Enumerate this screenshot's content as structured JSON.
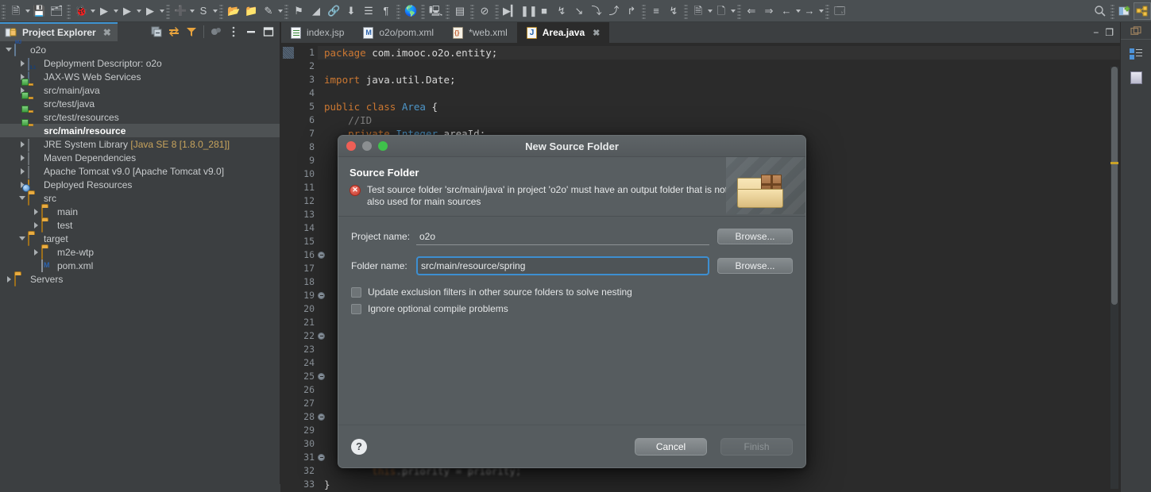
{
  "toolbar": {
    "icons": [
      {
        "name": "new-wizard-icon",
        "glyph": "🗎",
        "dropdown": true
      },
      {
        "name": "save-icon",
        "glyph": "💾",
        "dropdown": false
      },
      {
        "name": "save-all-icon",
        "glyph": "🗂",
        "dropdown": false
      },
      {
        "name": "debug-icon",
        "glyph": "🐞",
        "dropdown": true
      },
      {
        "name": "run-icon",
        "glyph": "▶",
        "dropdown": true
      },
      {
        "name": "run-server-icon",
        "glyph": "▶",
        "dropdown": true
      },
      {
        "name": "run-coverage-icon",
        "glyph": "▶",
        "dropdown": true
      },
      {
        "name": "new-java-project-icon",
        "glyph": "➕",
        "dropdown": true
      },
      {
        "name": "search-spring-icon",
        "glyph": "S",
        "dropdown": true
      },
      {
        "name": "open-type-icon",
        "glyph": "📂",
        "dropdown": false
      },
      {
        "name": "open-resource-icon",
        "glyph": "📁",
        "dropdown": false
      },
      {
        "name": "edit-icon",
        "glyph": "✎",
        "dropdown": true
      },
      {
        "name": "marker-icon",
        "glyph": "⚑",
        "dropdown": false
      },
      {
        "name": "ruler-icon",
        "glyph": "◢",
        "dropdown": false
      },
      {
        "name": "link-icon",
        "glyph": "🔗",
        "dropdown": false
      },
      {
        "name": "next-annotation-icon",
        "glyph": "⬇",
        "dropdown": false
      },
      {
        "name": "outline-list-icon",
        "glyph": "☰",
        "dropdown": false
      },
      {
        "name": "paragraph-icon",
        "glyph": "¶",
        "dropdown": false
      },
      {
        "name": "browser-icon",
        "glyph": "🌎",
        "dropdown": false
      },
      {
        "name": "new-server-icon",
        "glyph": "🖳",
        "dropdown": false
      },
      {
        "name": "console-icon",
        "glyph": "▤",
        "dropdown": false
      },
      {
        "name": "skip-breakpoints-icon",
        "glyph": "⊘",
        "dropdown": false
      },
      {
        "name": "resume-icon",
        "glyph": "▶▎",
        "dropdown": false
      },
      {
        "name": "suspend-icon",
        "glyph": "❚❚",
        "dropdown": false
      },
      {
        "name": "terminate-icon",
        "glyph": "■",
        "dropdown": false
      },
      {
        "name": "disconnect-icon",
        "glyph": "↯",
        "dropdown": false
      },
      {
        "name": "step-into-icon",
        "glyph": "↘",
        "dropdown": false
      },
      {
        "name": "step-over-icon",
        "glyph": "⤵",
        "dropdown": false
      },
      {
        "name": "step-return-icon",
        "glyph": "⤴",
        "dropdown": false
      },
      {
        "name": "drop-to-frame-icon",
        "glyph": "↱",
        "dropdown": false
      },
      {
        "name": "use-step-filters-icon",
        "glyph": "≡",
        "dropdown": false
      },
      {
        "name": "toggle-breakpoint-icon",
        "glyph": "↯",
        "dropdown": false
      },
      {
        "name": "previous-edit-icon",
        "glyph": "🗎",
        "dropdown": true
      },
      {
        "name": "next-edit-icon",
        "glyph": "🗋",
        "dropdown": true
      },
      {
        "name": "back-all-icon",
        "glyph": "⇐",
        "dropdown": false
      },
      {
        "name": "forward-all-icon",
        "glyph": "⇒",
        "dropdown": false
      },
      {
        "name": "back-icon",
        "glyph": "←",
        "dropdown": true
      },
      {
        "name": "forward-icon",
        "glyph": "→",
        "dropdown": true
      },
      {
        "name": "open-perspective-icon",
        "glyph": "🗔",
        "dropdown": false
      }
    ],
    "right_icons": [
      {
        "name": "quick-access-search-icon",
        "glyph": "🔍"
      },
      {
        "name": "open-perspective-icon",
        "glyph": "⊞"
      },
      {
        "name": "java-ee-perspective-icon",
        "glyph": "⚙"
      }
    ]
  },
  "explorer": {
    "tab_label": "Project Explorer",
    "tools": [
      {
        "name": "collapse-all-icon",
        "glyph": "⊟"
      },
      {
        "name": "link-with-editor-icon",
        "glyph": "⇄"
      },
      {
        "name": "view-menu-filter-icon",
        "glyph": "▼"
      },
      {
        "name": "focus-on-active-task-icon",
        "glyph": "⬢"
      },
      {
        "name": "view-menu-icon",
        "glyph": "⋮"
      },
      {
        "name": "minimize-icon",
        "glyph": "−"
      },
      {
        "name": "maximize-icon",
        "glyph": "□"
      }
    ],
    "tree": [
      {
        "label": "o2o",
        "indent": 0,
        "twisty": "down",
        "icon": "project",
        "selected": false
      },
      {
        "label": "Deployment Descriptor: o2o",
        "indent": 1,
        "twisty": "right",
        "icon": "deploy",
        "selected": false
      },
      {
        "label": "JAX-WS Web Services",
        "indent": 1,
        "twisty": "right",
        "icon": "ws",
        "selected": false
      },
      {
        "label": "src/main/java",
        "indent": 1,
        "twisty": "right",
        "icon": "srcfolder",
        "selected": false
      },
      {
        "label": "src/test/java",
        "indent": 1,
        "twisty": "none",
        "icon": "srcfolder",
        "selected": false
      },
      {
        "label": "src/test/resources",
        "indent": 1,
        "twisty": "none",
        "icon": "srcfolder",
        "selected": false
      },
      {
        "label": "src/main/resource",
        "indent": 1,
        "twisty": "none",
        "icon": "srcfolder",
        "selected": true
      },
      {
        "label": "JRE System Library",
        "suffix": " [Java SE 8 [1.8.0_281]]",
        "indent": 1,
        "twisty": "right",
        "icon": "lib",
        "selected": false
      },
      {
        "label": "Maven Dependencies",
        "indent": 1,
        "twisty": "right",
        "icon": "lib",
        "selected": false
      },
      {
        "label": "Apache Tomcat v9.0 [Apache Tomcat v9.0]",
        "indent": 1,
        "twisty": "right",
        "icon": "lib",
        "selected": false
      },
      {
        "label": "Deployed Resources",
        "indent": 1,
        "twisty": "right",
        "icon": "deployed",
        "selected": false
      },
      {
        "label": "src",
        "indent": 1,
        "twisty": "down",
        "icon": "folder",
        "selected": false
      },
      {
        "label": "main",
        "indent": 2,
        "twisty": "right",
        "icon": "folder",
        "selected": false
      },
      {
        "label": "test",
        "indent": 2,
        "twisty": "right",
        "icon": "folder",
        "selected": false
      },
      {
        "label": "target",
        "indent": 1,
        "twisty": "down",
        "icon": "folder",
        "selected": false
      },
      {
        "label": "m2e-wtp",
        "indent": 2,
        "twisty": "right",
        "icon": "folder",
        "selected": false
      },
      {
        "label": "pom.xml",
        "indent": 2,
        "twisty": "none",
        "icon": "maven",
        "selected": false
      },
      {
        "label": "Servers",
        "indent": 0,
        "twisty": "right",
        "icon": "folder",
        "selected": false
      }
    ]
  },
  "editor": {
    "tabs": [
      {
        "label": "index.jsp",
        "icon": "jsp-file-icon",
        "active": false,
        "closable": false
      },
      {
        "label": "o2o/pom.xml",
        "icon": "maven-file-icon",
        "active": false,
        "closable": false
      },
      {
        "label": "*web.xml",
        "icon": "xml-file-icon",
        "active": false,
        "closable": false
      },
      {
        "label": "Area.java",
        "icon": "java-file-icon",
        "active": true,
        "closable": true
      }
    ],
    "window_buttons": [
      {
        "name": "minimize-editor-icon",
        "glyph": "−"
      },
      {
        "name": "restore-editor-icon",
        "glyph": "❐"
      }
    ],
    "lines": [
      {
        "n": 1,
        "fold": false,
        "cur": true,
        "html": "<span class='kw'>package</span> <span class='pl'>com.imooc.o2o.entity;</span>"
      },
      {
        "n": 2,
        "fold": false,
        "cur": false,
        "html": ""
      },
      {
        "n": 3,
        "fold": false,
        "cur": false,
        "html": "<span class='kw'>import</span> <span class='pl'>java.util.Date;</span>"
      },
      {
        "n": 4,
        "fold": false,
        "cur": false,
        "html": ""
      },
      {
        "n": 5,
        "fold": false,
        "cur": false,
        "html": "<span class='kw'>public</span> <span class='kw'>class</span> <span class='ty'>Area</span> <span class='pl'>{</span>"
      },
      {
        "n": 6,
        "fold": false,
        "cur": false,
        "html": "    <span class='cm'>//ID</span>"
      },
      {
        "n": 7,
        "fold": false,
        "cur": false,
        "html": "    <span class='kw'>private</span> <span class='ty'>Integer</span> <span class='pl'>areaId;</span>"
      },
      {
        "n": 8,
        "fold": false,
        "cur": false,
        "html": ""
      },
      {
        "n": 9,
        "fold": false,
        "cur": false,
        "html": ""
      },
      {
        "n": 10,
        "fold": false,
        "cur": false,
        "html": ""
      },
      {
        "n": 11,
        "fold": false,
        "cur": false,
        "html": ""
      },
      {
        "n": 12,
        "fold": false,
        "cur": false,
        "html": ""
      },
      {
        "n": 13,
        "fold": false,
        "cur": false,
        "html": ""
      },
      {
        "n": 14,
        "fold": false,
        "cur": false,
        "html": ""
      },
      {
        "n": 15,
        "fold": false,
        "cur": false,
        "html": ""
      },
      {
        "n": 16,
        "fold": true,
        "cur": false,
        "html": ""
      },
      {
        "n": 17,
        "fold": false,
        "cur": false,
        "html": ""
      },
      {
        "n": 18,
        "fold": false,
        "cur": false,
        "html": ""
      },
      {
        "n": 19,
        "fold": true,
        "cur": false,
        "html": ""
      },
      {
        "n": 20,
        "fold": false,
        "cur": false,
        "html": ""
      },
      {
        "n": 21,
        "fold": false,
        "cur": false,
        "html": ""
      },
      {
        "n": 22,
        "fold": true,
        "cur": false,
        "html": ""
      },
      {
        "n": 23,
        "fold": false,
        "cur": false,
        "html": ""
      },
      {
        "n": 24,
        "fold": false,
        "cur": false,
        "html": ""
      },
      {
        "n": 25,
        "fold": true,
        "cur": false,
        "html": ""
      },
      {
        "n": 26,
        "fold": false,
        "cur": false,
        "html": ""
      },
      {
        "n": 27,
        "fold": false,
        "cur": false,
        "html": ""
      },
      {
        "n": 28,
        "fold": true,
        "cur": false,
        "html": ""
      },
      {
        "n": 29,
        "fold": false,
        "cur": false,
        "html": ""
      },
      {
        "n": 30,
        "fold": false,
        "cur": false,
        "html": ""
      },
      {
        "n": 31,
        "fold": true,
        "cur": false,
        "html": ""
      },
      {
        "n": 32,
        "fold": false,
        "cur": false,
        "blur": true,
        "html": "        <span class='kw'>this</span><span class='pl'>.priority = priority;</span>"
      },
      {
        "n": 33,
        "fold": false,
        "cur": false,
        "html": "<span class='pl'>}</span>"
      }
    ]
  },
  "right_strip": {
    "buttons": [
      {
        "name": "restore-view-icon",
        "glyph": "❐"
      },
      {
        "name": "outline-view-icon",
        "glyph": "≡"
      },
      {
        "name": "task-list-view-icon",
        "glyph": "▤"
      }
    ]
  },
  "dialog": {
    "title": "New Source Folder",
    "traffic_lights": [
      "close",
      "minimize",
      "zoom"
    ],
    "header_title": "Source Folder",
    "error_message": "Test source folder 'src/main/java' in project 'o2o' must have an output folder that is not also used for main sources",
    "fields": [
      {
        "label": "Project name:",
        "value": "o2o",
        "button": "Browse...",
        "focused": false
      },
      {
        "label": "Folder name:",
        "value": "src/main/resource/spring",
        "button": "Browse...",
        "focused": true
      }
    ],
    "checkboxes": [
      {
        "label": "Update exclusion filters in other source folders to solve nesting",
        "checked": false
      },
      {
        "label": "Ignore optional compile problems",
        "checked": false
      }
    ],
    "help_label": "?",
    "cancel_label": "Cancel",
    "finish_label": "Finish",
    "finish_disabled": true
  },
  "colors": {
    "accent": "#3d8fd1",
    "toolbar_bg": "#4a4f52",
    "panel_bg": "#3c3f41",
    "editor_bg": "#2b2b2b",
    "dialog_bg": "#565c5f",
    "keyword": "#cc7832",
    "type": "#4e96c8",
    "comment": "#808080",
    "error_red": "#c2392b",
    "tab_highlight": "#3f94d2"
  }
}
